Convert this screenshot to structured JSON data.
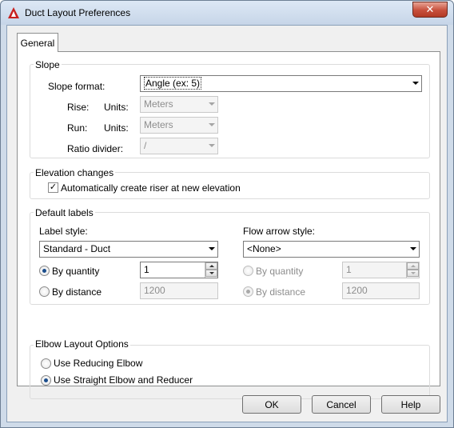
{
  "window": {
    "title": "Duct Layout Preferences",
    "close_glyph": "✕"
  },
  "tabs": [
    {
      "label": "General"
    }
  ],
  "slope": {
    "title": "Slope",
    "format_label": "Slope format:",
    "format_value": "Angle (ex: 5)",
    "rise_label": "Rise:",
    "rise_units_label": "Units:",
    "rise_units_value": "Meters",
    "run_label": "Run:",
    "run_units_label": "Units:",
    "run_units_value": "Meters",
    "ratio_label": "Ratio divider:",
    "ratio_value": "/"
  },
  "elevation": {
    "title": "Elevation changes",
    "auto_riser_label": "Automatically create riser at new elevation",
    "auto_riser_checked": true,
    "check_glyph": "✓"
  },
  "default_labels": {
    "title": "Default labels",
    "label_style_label": "Label style:",
    "label_style_value": "Standard - Duct",
    "by_quantity_label": "By quantity",
    "quantity_value": "1",
    "by_distance_label": "By distance",
    "distance_value": "1200",
    "flow_arrow_label": "Flow arrow style:",
    "flow_arrow_value": "<None>",
    "flow_by_quantity_label": "By quantity",
    "flow_quantity_value": "1",
    "flow_by_distance_label": "By distance",
    "flow_distance_value": "1200"
  },
  "elbow": {
    "title": "Elbow Layout Options",
    "reducing_label": "Use Reducing Elbow",
    "straight_label": "Use Straight Elbow and Reducer"
  },
  "buttons": {
    "ok": "OK",
    "cancel": "Cancel",
    "help": "Help"
  },
  "colors": {
    "accent": "#1a4d8c",
    "close": "#c7503c",
    "logo": "#c8201e"
  }
}
